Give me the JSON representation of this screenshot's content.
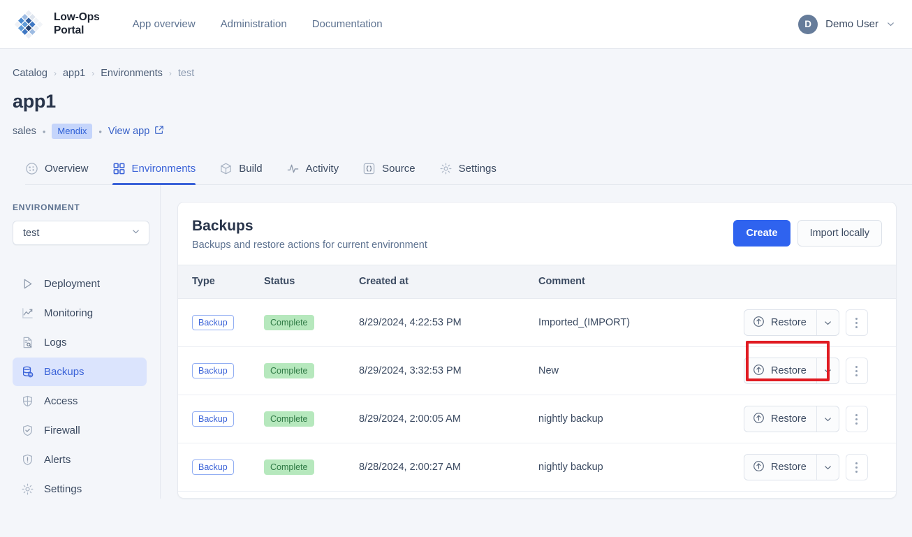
{
  "topnav": {
    "brand": "Low-Ops\nPortal",
    "logo_icon": "diamond-grid-logo",
    "links": [
      {
        "label": "App overview"
      },
      {
        "label": "Administration"
      },
      {
        "label": "Documentation"
      }
    ],
    "user": {
      "initial": "D",
      "name": "Demo User",
      "caret_icon": "chevron-down-icon"
    }
  },
  "breadcrumb": {
    "items": [
      {
        "label": "Catalog"
      },
      {
        "label": "app1"
      },
      {
        "label": "Environments"
      },
      {
        "label": "test"
      }
    ],
    "separator": "›"
  },
  "page": {
    "title": "app1",
    "team": "sales",
    "platform_tag": "Mendix",
    "view_app_label": "View app",
    "view_app_icon": "external-link-icon",
    "dot": "•"
  },
  "tabs": [
    {
      "label": "Overview",
      "icon": "gauge-icon",
      "active": false
    },
    {
      "label": "Environments",
      "icon": "grid-icon",
      "active": true
    },
    {
      "label": "Build",
      "icon": "package-icon",
      "active": false
    },
    {
      "label": "Activity",
      "icon": "pulse-icon",
      "active": false
    },
    {
      "label": "Source",
      "icon": "braces-icon",
      "active": false
    },
    {
      "label": "Settings",
      "icon": "gear-icon",
      "active": false
    }
  ],
  "sidebar": {
    "section_label": "ENVIRONMENT",
    "environment_select": {
      "value": "test",
      "caret_icon": "chevron-down-icon"
    },
    "items": [
      {
        "label": "Deployment",
        "icon": "play-icon",
        "active": false
      },
      {
        "label": "Monitoring",
        "icon": "chart-line-icon",
        "active": false
      },
      {
        "label": "Logs",
        "icon": "doc-search-icon",
        "active": false
      },
      {
        "label": "Backups",
        "icon": "database-sync-icon",
        "active": true
      },
      {
        "label": "Access",
        "icon": "shield-grid-icon",
        "active": false
      },
      {
        "label": "Firewall",
        "icon": "shield-check-icon",
        "active": false
      },
      {
        "label": "Alerts",
        "icon": "shield-alert-icon",
        "active": false
      },
      {
        "label": "Settings",
        "icon": "gear-icon",
        "active": false
      }
    ]
  },
  "backups_card": {
    "title": "Backups",
    "subtitle": "Backups and restore actions for current environment",
    "create_label": "Create",
    "import_label": "Import locally",
    "columns": [
      "Type",
      "Status",
      "Created at",
      "Comment",
      ""
    ],
    "row_action": {
      "restore_label": "Restore",
      "restore_icon": "upload-circle-icon",
      "caret_icon": "chevron-down-icon",
      "kebab_icon": "kebab-menu-icon"
    },
    "rows": [
      {
        "type": "Backup",
        "status": "Complete",
        "created_at": "8/29/2024, 4:22:53 PM",
        "comment": "Imported_(IMPORT)"
      },
      {
        "type": "Backup",
        "status": "Complete",
        "created_at": "8/29/2024, 3:32:53 PM",
        "comment": "New"
      },
      {
        "type": "Backup",
        "status": "Complete",
        "created_at": "8/29/2024, 2:00:05 AM",
        "comment": "nightly backup"
      },
      {
        "type": "Backup",
        "status": "Complete",
        "created_at": "8/28/2024, 2:00:27 AM",
        "comment": "nightly backup"
      }
    ]
  },
  "annotation": {
    "highlight_color": "#e01b22",
    "target": "restore-button-row-1"
  },
  "colors": {
    "page_background": "#f4f6fa",
    "accent_blue": "#3b63d8",
    "primary_button": "#2f63ef",
    "status_green_bg": "#b6e8bd",
    "status_green_text": "#2f7a45"
  }
}
